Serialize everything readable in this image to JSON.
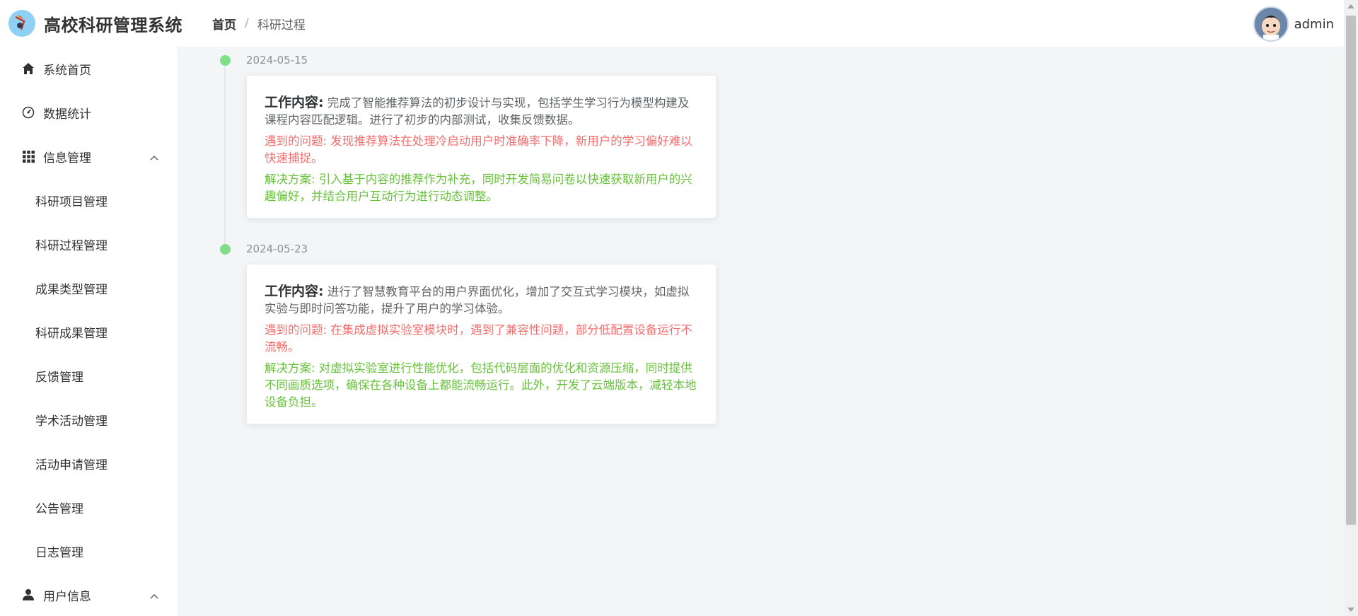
{
  "app": {
    "title": "高校科研管理系统"
  },
  "breadcrumb": {
    "home": "首页",
    "separator": "/",
    "current": "科研过程"
  },
  "user": {
    "name": "admin"
  },
  "sidebar": {
    "items": [
      {
        "label": "系统首页",
        "icon": "home-icon"
      },
      {
        "label": "数据统计",
        "icon": "dashboard-icon"
      },
      {
        "label": "信息管理",
        "icon": "grid-icon",
        "expanded": true
      },
      {
        "label": "科研项目管理"
      },
      {
        "label": "科研过程管理"
      },
      {
        "label": "成果类型管理"
      },
      {
        "label": "科研成果管理"
      },
      {
        "label": "反馈管理"
      },
      {
        "label": "学术活动管理"
      },
      {
        "label": "活动申请管理"
      },
      {
        "label": "公告管理"
      },
      {
        "label": "日志管理"
      },
      {
        "label": "用户信息",
        "icon": "user-icon",
        "expanded": true
      }
    ]
  },
  "timeline": [
    {
      "date": "2024-05-15",
      "work_label": "工作内容:",
      "work_text": "完成了智能推荐算法的初步设计与实现，包括学生学习行为模型构建及课程内容匹配逻辑。进行了初步的内部测试，收集反馈数据。",
      "problem": "遇到的问题: 发现推荐算法在处理冷启动用户时准确率下降，新用户的学习偏好难以快速捕捉。",
      "solution": "解决方案: 引入基于内容的推荐作为补充，同时开发简易问卷以快速获取新用户的兴趣偏好，并结合用户互动行为进行动态调整。"
    },
    {
      "date": "2024-05-23",
      "work_label": "工作内容:",
      "work_text": "进行了智慧教育平台的用户界面优化，增加了交互式学习模块，如虚拟实验与即时问答功能，提升了用户的学习体验。",
      "problem": "遇到的问题: 在集成虚拟实验室模块时，遇到了兼容性问题，部分低配置设备运行不流畅。",
      "solution": "解决方案: 对虚拟实验室进行性能优化，包括代码层面的优化和资源压缩，同时提供不同画质选项，确保在各种设备上都能流畅运行。此外，开发了云端版本，减轻本地设备负担。"
    }
  ],
  "colors": {
    "problem": "#f56c6c",
    "solution": "#67c23a",
    "timeline_dot": "#7fe089",
    "main_bg": "#f4f5f7"
  }
}
